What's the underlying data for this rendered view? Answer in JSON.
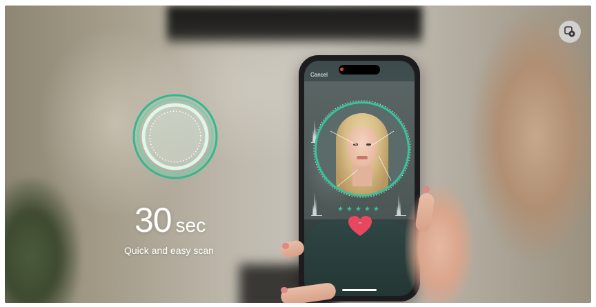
{
  "overlay": {
    "timer_value": "30",
    "timer_unit": "sec",
    "tagline": "Quick and easy scan"
  },
  "phone": {
    "cancel_label": "Cancel",
    "rating_stars": "★★★★★",
    "heart_value": "--"
  },
  "icons": {
    "pip": "picture-in-picture-icon",
    "scan": "scan-ring-icon",
    "heart": "heart-icon"
  },
  "colors": {
    "accent": "#35c59b",
    "heart": "#e8485f"
  }
}
